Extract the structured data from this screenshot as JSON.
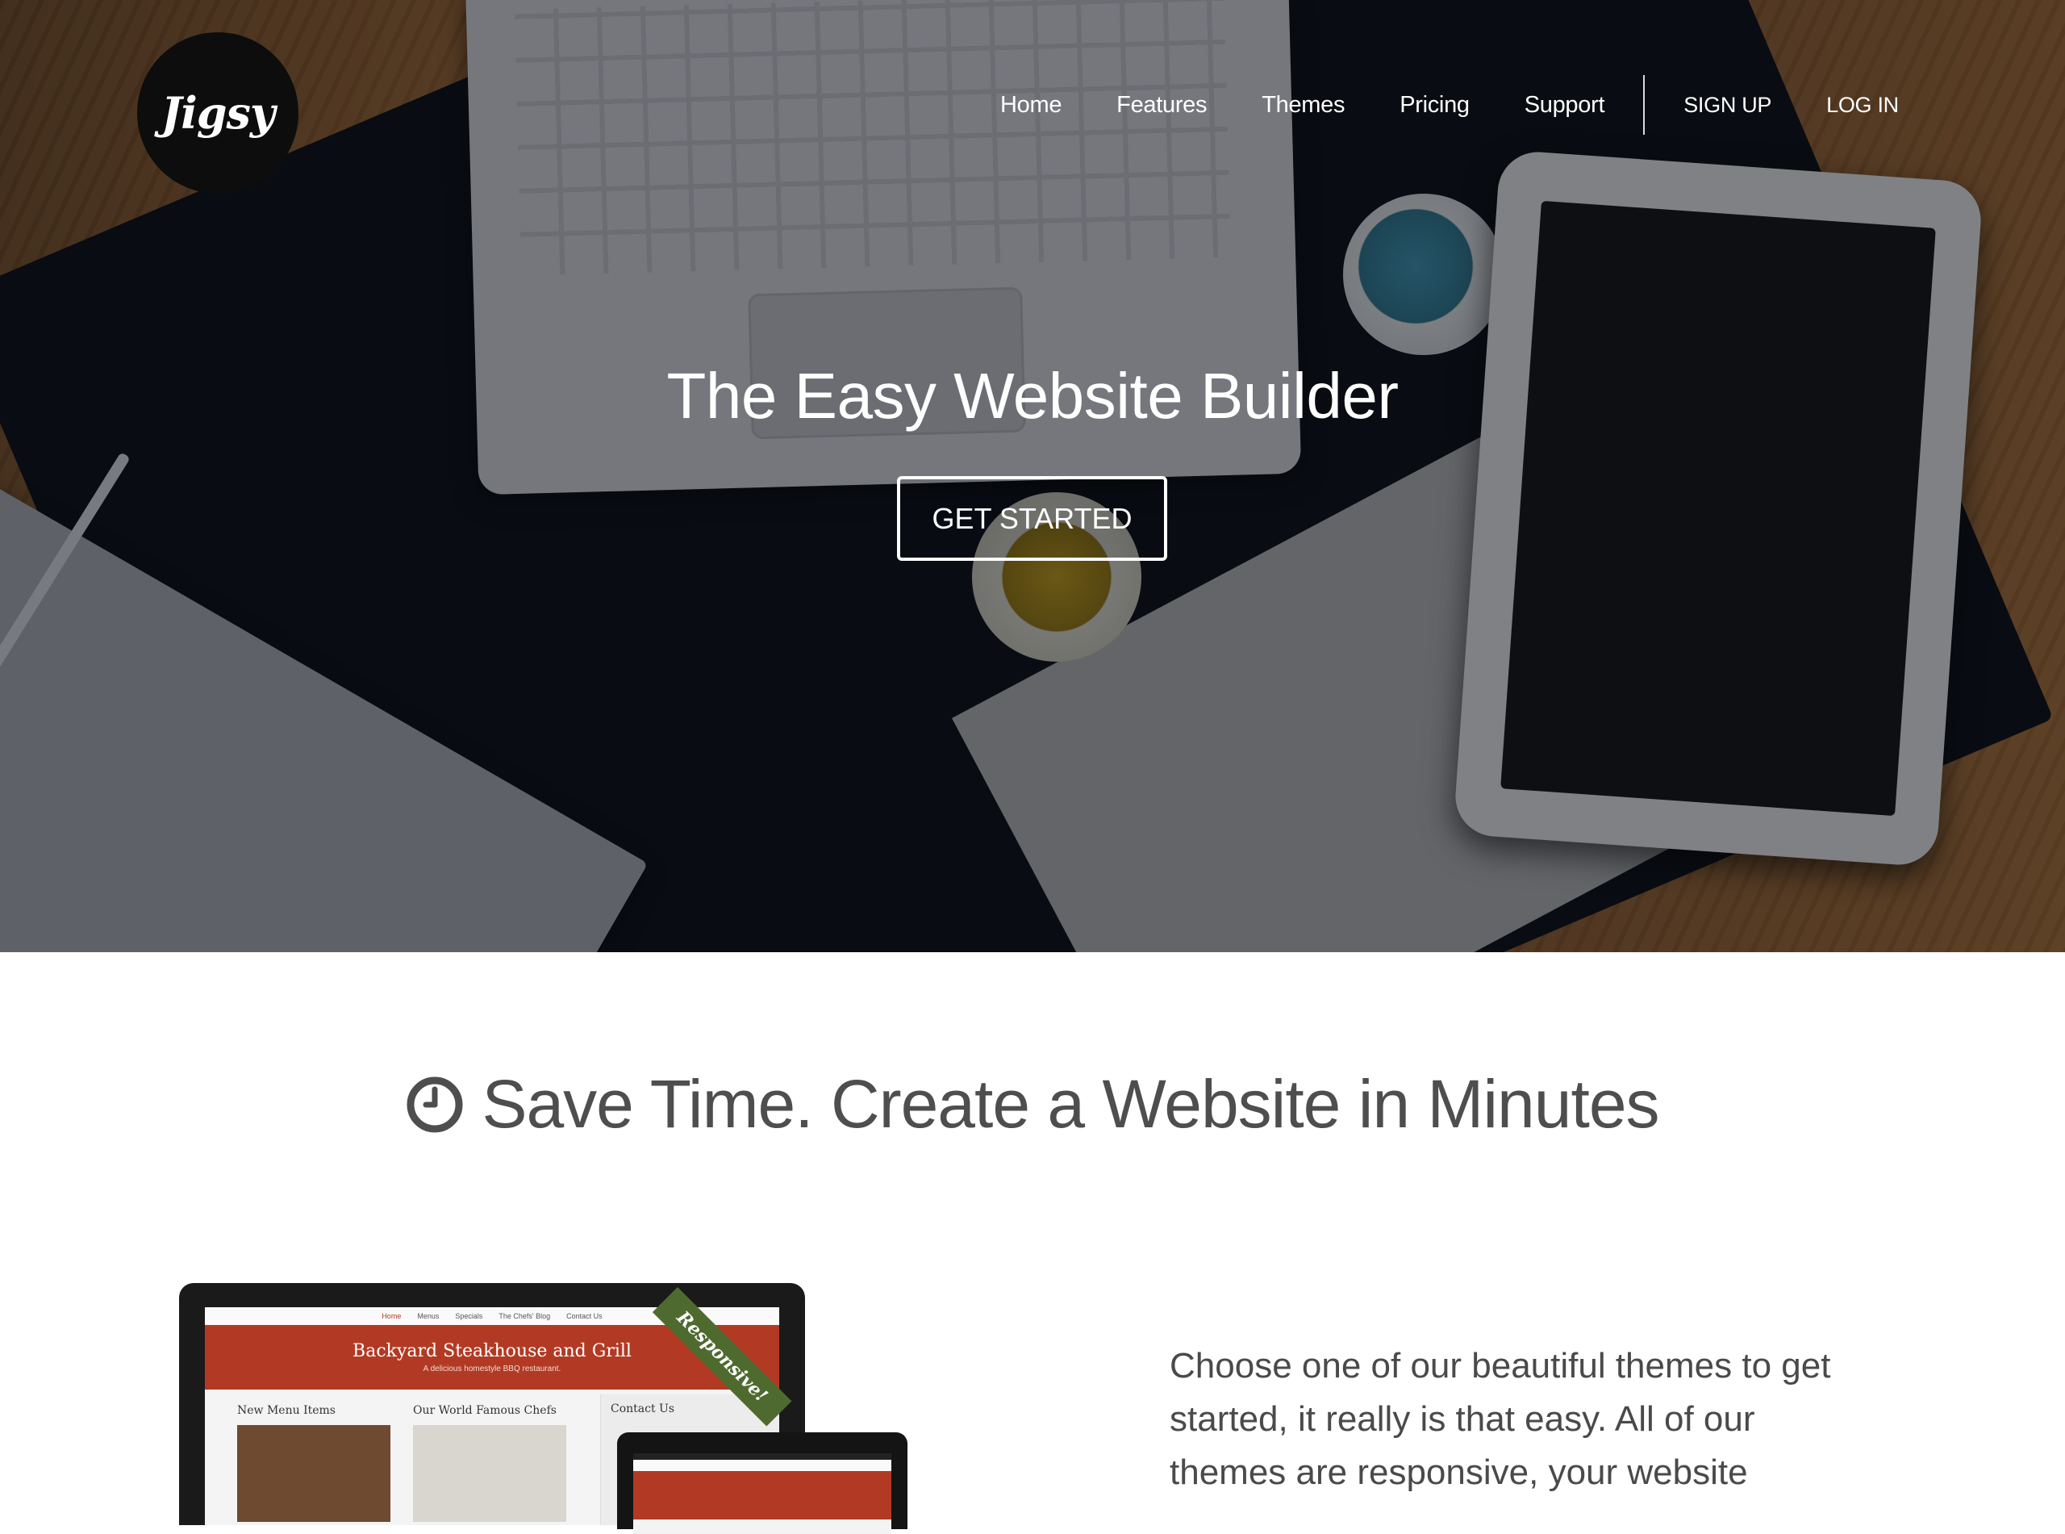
{
  "header": {
    "logo_text": "Jigsy",
    "nav": [
      "Home",
      "Features",
      "Themes",
      "Pricing",
      "Support"
    ],
    "sign_up": "SIGN UP",
    "log_in": "LOG IN"
  },
  "hero": {
    "title": "The Easy Website Builder",
    "cta": "GET STARTED"
  },
  "section": {
    "icon": "clock-icon",
    "title": "Save Time. Create a Website in Minutes",
    "paragraph": "Choose one of our beautiful themes to get started, it really is that easy. All of our themes are responsive, your website"
  },
  "mockup": {
    "ribbon": "Responsive!",
    "nav_items": [
      "Home",
      "Menus",
      "Specials",
      "The Chefs' Blog",
      "Contact Us"
    ],
    "site_title": "Backyard Steakhouse and Grill",
    "site_subtitle": "A delicious homestyle BBQ restaurant.",
    "col1_title": "New Menu Items",
    "col2_title": "Our World Famous Chefs",
    "contact_title": "Contact Us"
  },
  "colors": {
    "accent_red": "#b23a24",
    "ribbon_green": "#4f6a2f",
    "text_gray": "#4e4e4e"
  }
}
